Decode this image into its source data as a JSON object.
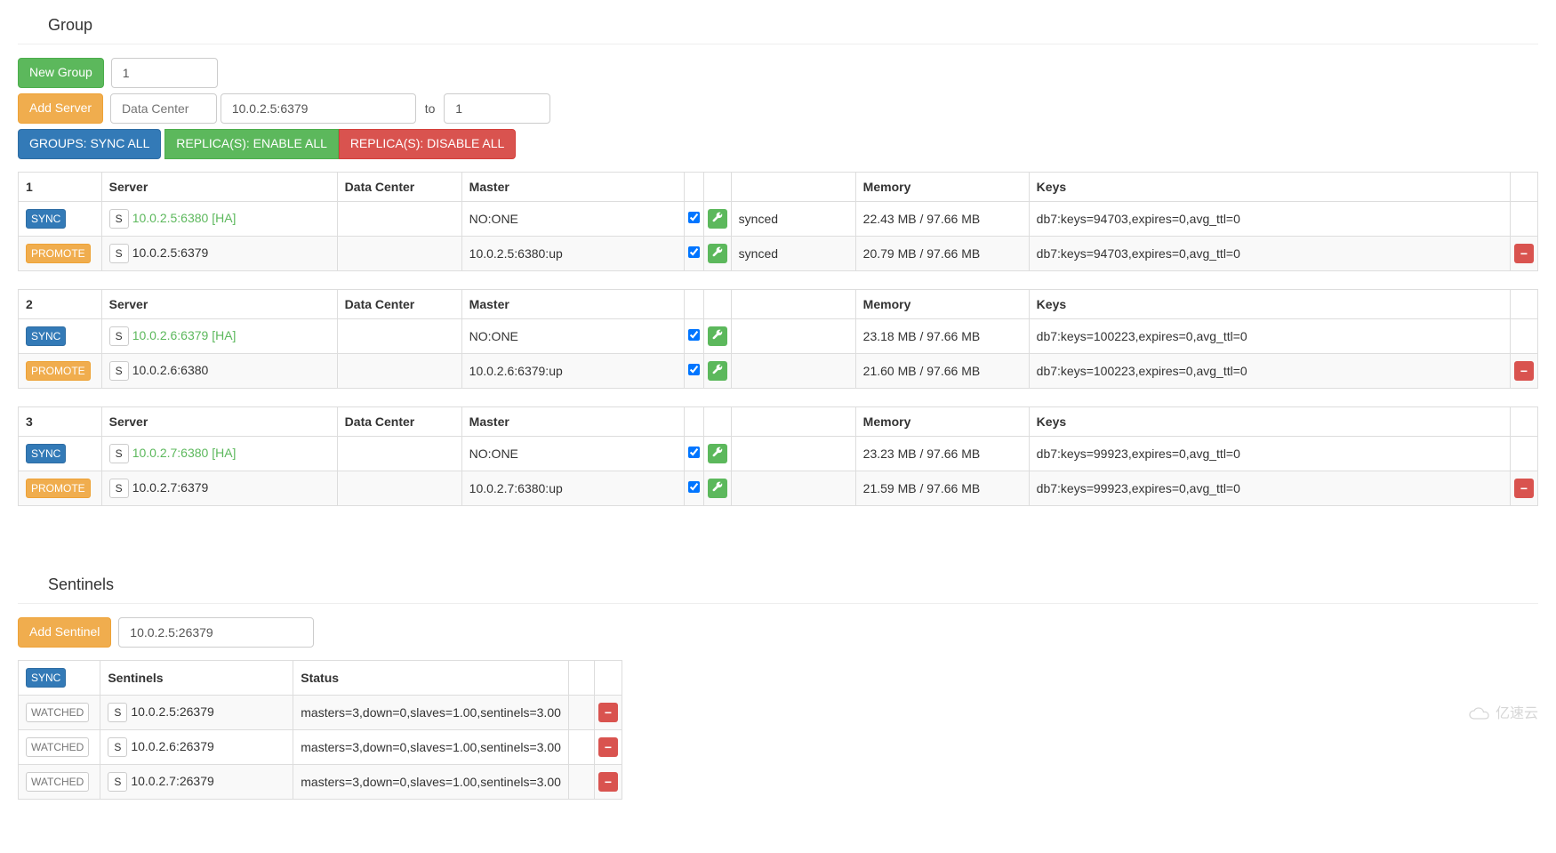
{
  "group": {
    "title": "Group",
    "new_group_label": "New Group",
    "new_group_value": "1",
    "add_server_label": "Add Server",
    "data_center_placeholder": "Data Center",
    "server_value": "10.0.2.5:6379",
    "to_label": "to",
    "to_value": "1",
    "sync_all_label": "GROUPS: SYNC ALL",
    "replicas_enable_label": "REPLICA(S): ENABLE ALL",
    "replicas_disable_label": "REPLICA(S): DISABLE ALL",
    "sync_btn": "SYNC",
    "promote_btn": "PROMOTE",
    "s_badge": "S",
    "headers": {
      "server": "Server",
      "data_center": "Data Center",
      "master": "Master",
      "memory": "Memory",
      "keys": "Keys"
    },
    "tables": [
      {
        "id": "1",
        "rows": [
          {
            "kind": "master",
            "server": "10.0.2.5:6380",
            "ha": "[HA]",
            "dc": "",
            "master": "NO:ONE",
            "checked": true,
            "sync": "synced",
            "memory": "22.43 MB / 97.66 MB",
            "keys": "db7:keys=94703,expires=0,avg_ttl=0",
            "deletable": false
          },
          {
            "kind": "slave",
            "server": "10.0.2.5:6379",
            "ha": "",
            "dc": "",
            "master": "10.0.2.5:6380:up",
            "checked": true,
            "sync": "synced",
            "memory": "20.79 MB / 97.66 MB",
            "keys": "db7:keys=94703,expires=0,avg_ttl=0",
            "deletable": true
          }
        ]
      },
      {
        "id": "2",
        "rows": [
          {
            "kind": "master",
            "server": "10.0.2.6:6379",
            "ha": "[HA]",
            "dc": "",
            "master": "NO:ONE",
            "checked": true,
            "sync": "",
            "memory": "23.18 MB / 97.66 MB",
            "keys": "db7:keys=100223,expires=0,avg_ttl=0",
            "deletable": false
          },
          {
            "kind": "slave",
            "server": "10.0.2.6:6380",
            "ha": "",
            "dc": "",
            "master": "10.0.2.6:6379:up",
            "checked": true,
            "sync": "",
            "memory": "21.60 MB / 97.66 MB",
            "keys": "db7:keys=100223,expires=0,avg_ttl=0",
            "deletable": true
          }
        ]
      },
      {
        "id": "3",
        "rows": [
          {
            "kind": "master",
            "server": "10.0.2.7:6380",
            "ha": "[HA]",
            "dc": "",
            "master": "NO:ONE",
            "checked": true,
            "sync": "",
            "memory": "23.23 MB / 97.66 MB",
            "keys": "db7:keys=99923,expires=0,avg_ttl=0",
            "deletable": false
          },
          {
            "kind": "slave",
            "server": "10.0.2.7:6379",
            "ha": "",
            "dc": "",
            "master": "10.0.2.7:6380:up",
            "checked": true,
            "sync": "",
            "memory": "21.59 MB / 97.66 MB",
            "keys": "db7:keys=99923,expires=0,avg_ttl=0",
            "deletable": true
          }
        ]
      }
    ]
  },
  "sentinels": {
    "title": "Sentinels",
    "add_label": "Add Sentinel",
    "add_value": "10.0.2.5:26379",
    "sync_btn": "SYNC",
    "watched_btn": "WATCHED",
    "s_badge": "S",
    "headers": {
      "sentinels": "Sentinels",
      "status": "Status"
    },
    "rows": [
      {
        "addr": "10.0.2.5:26379",
        "status": "masters=3,down=0,slaves=1.00,sentinels=3.00"
      },
      {
        "addr": "10.0.2.6:26379",
        "status": "masters=3,down=0,slaves=1.00,sentinels=3.00"
      },
      {
        "addr": "10.0.2.7:26379",
        "status": "masters=3,down=0,slaves=1.00,sentinels=3.00"
      }
    ]
  },
  "watermark": "亿速云"
}
